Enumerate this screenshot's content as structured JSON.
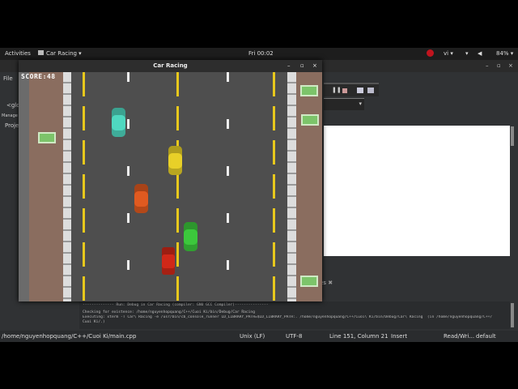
{
  "topbar": {
    "activities": "Activities",
    "app_menu": "Car Racing ▾",
    "clock": "Fri 00:02",
    "lang": "vi ▾",
    "battery": "84% ▾"
  },
  "ide": {
    "menu_file": "File",
    "symbol_field": "<glo",
    "management": "Manage",
    "projects_tab": "Proje",
    "logs_tab": "es",
    "log_lines": [
      "-------------- Run: Debug in Car Racing (compiler: GNU GCC Compiler)---------------",
      "Checking for existence: /home/nguyenhopquang/C++/Cuoi Ki/bin/Debug/Car Racing",
      "Executing: xterm -T Car\\ Racing -e /usr/bin/cb_console_runner LD_LIBRARY_PATH=$LD_LIBRARY_PATH:. /home/nguyenhopquang/C++/Cuoi\\ Ki/bin/Debug/Car\\ Racing  (in /home/nguyenhopquang/C++/",
      "Cuoi Ki/.)"
    ]
  },
  "status": {
    "path": "/home/nguyenhopquang/C++/Cuoi Ki/main.cpp",
    "eol": "Unix (LF)",
    "encoding": "UTF-8",
    "position": "Line 151, Column 21",
    "mode": "Insert",
    "access": "Read/Wri...",
    "theme": "default"
  },
  "game": {
    "window_title": "Car Racing",
    "score": "SCORE:48",
    "cars": [
      {
        "name": "cyan",
        "color": "#4fd8c0"
      },
      {
        "name": "yellow",
        "color": "#e8d028"
      },
      {
        "name": "orange",
        "color": "#e05a20"
      },
      {
        "name": "green",
        "color": "#3cc83c"
      },
      {
        "name": "player-red-f1",
        "color": "#d02818"
      }
    ]
  }
}
